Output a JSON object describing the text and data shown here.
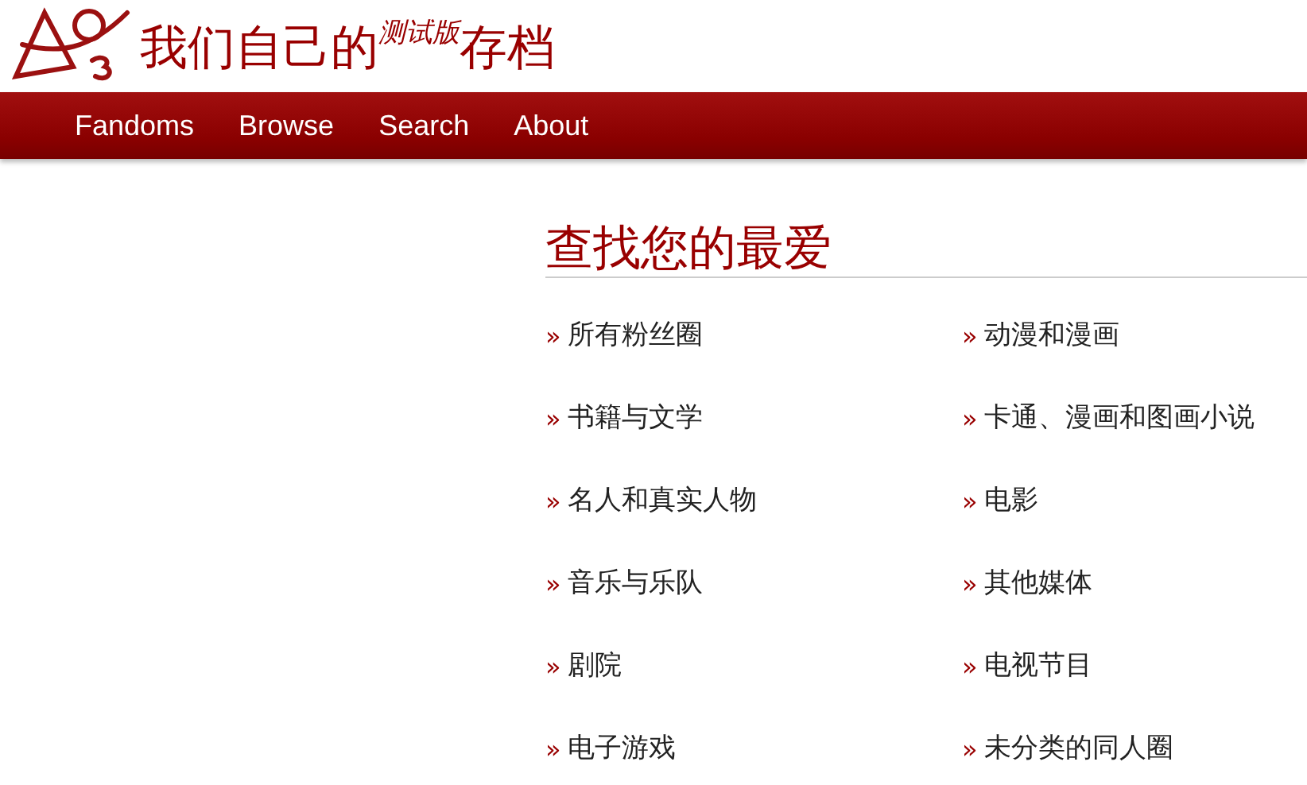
{
  "site_title": {
    "before": "我们自己的",
    "beta": "测试版",
    "after": "存档"
  },
  "nav": [
    {
      "label": "Fandoms"
    },
    {
      "label": "Browse"
    },
    {
      "label": "Search"
    },
    {
      "label": "About"
    }
  ],
  "section": {
    "heading": "查找您的最爱",
    "items": [
      {
        "marker": "»",
        "label": "所有粉丝圈"
      },
      {
        "marker": "»",
        "label": "动漫和漫画"
      },
      {
        "marker": "»",
        "label": "书籍与文学"
      },
      {
        "marker": "»",
        "label": "卡通、漫画和图画小说"
      },
      {
        "marker": "»",
        "label": "名人和真实人物"
      },
      {
        "marker": "»",
        "label": "电影"
      },
      {
        "marker": "»",
        "label": "音乐与乐队"
      },
      {
        "marker": "»",
        "label": "其他媒体"
      },
      {
        "marker": "»",
        "label": "剧院"
      },
      {
        "marker": "»",
        "label": "电视节目"
      },
      {
        "marker": "»",
        "label": "电子游戏"
      },
      {
        "marker": "»",
        "label": "未分类的同人圈"
      }
    ]
  }
}
